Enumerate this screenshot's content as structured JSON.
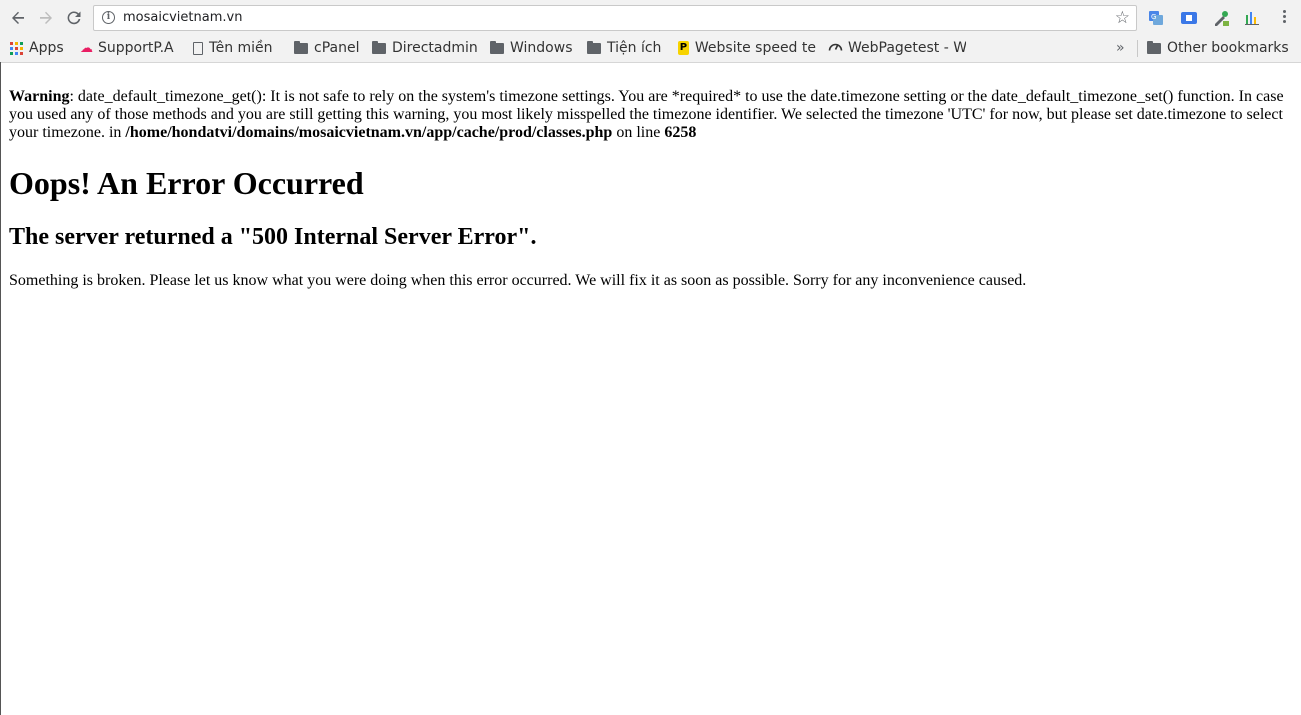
{
  "browser": {
    "url": "mosaicvietnam.vn",
    "nav_icons": [
      "back-icon",
      "forward-icon",
      "reload-icon"
    ],
    "extensions": [
      "translate-icon",
      "extension-icon",
      "eyedropper-icon",
      "chart-icon"
    ],
    "bookmarks": [
      {
        "label": "Apps",
        "icon": "apps-grid-icon"
      },
      {
        "label": "SupportP.A",
        "icon": "support-icon"
      },
      {
        "label": "Tên miền",
        "icon": "page-icon"
      },
      {
        "label": "cPanel",
        "icon": "folder-icon"
      },
      {
        "label": "Directadmin",
        "icon": "folder-icon"
      },
      {
        "label": "Windows",
        "icon": "folder-icon"
      },
      {
        "label": "Tiện ích",
        "icon": "folder-icon"
      },
      {
        "label": "Website speed te",
        "icon": "p-badge-icon"
      },
      {
        "label": "WebPagetest - W",
        "icon": "gauge-icon"
      }
    ],
    "overflow_label": "»",
    "other_bookmarks": "Other bookmarks"
  },
  "page": {
    "warning_label": "Warning",
    "warning_text": ": date_default_timezone_get(): It is not safe to rely on the system's timezone settings. You are *required* to use the date.timezone setting or the date_default_timezone_set() function. In case you used any of those methods and you are still getting this warning, you most likely misspelled the timezone identifier. We selected the timezone 'UTC' for now, but please set date.timezone to select your timezone. in ",
    "warning_path": "/home/hondatvi/domains/mosaicvietnam.vn/app/cache/prod/classes.php",
    "warning_on_line": " on line ",
    "warning_line": "6258",
    "title": "Oops! An Error Occurred",
    "subtitle": "The server returned a \"500 Internal Server Error\".",
    "message": "Something is broken. Please let us know what you were doing when this error occurred. We will fix it as soon as possible. Sorry for any inconvenience caused."
  }
}
